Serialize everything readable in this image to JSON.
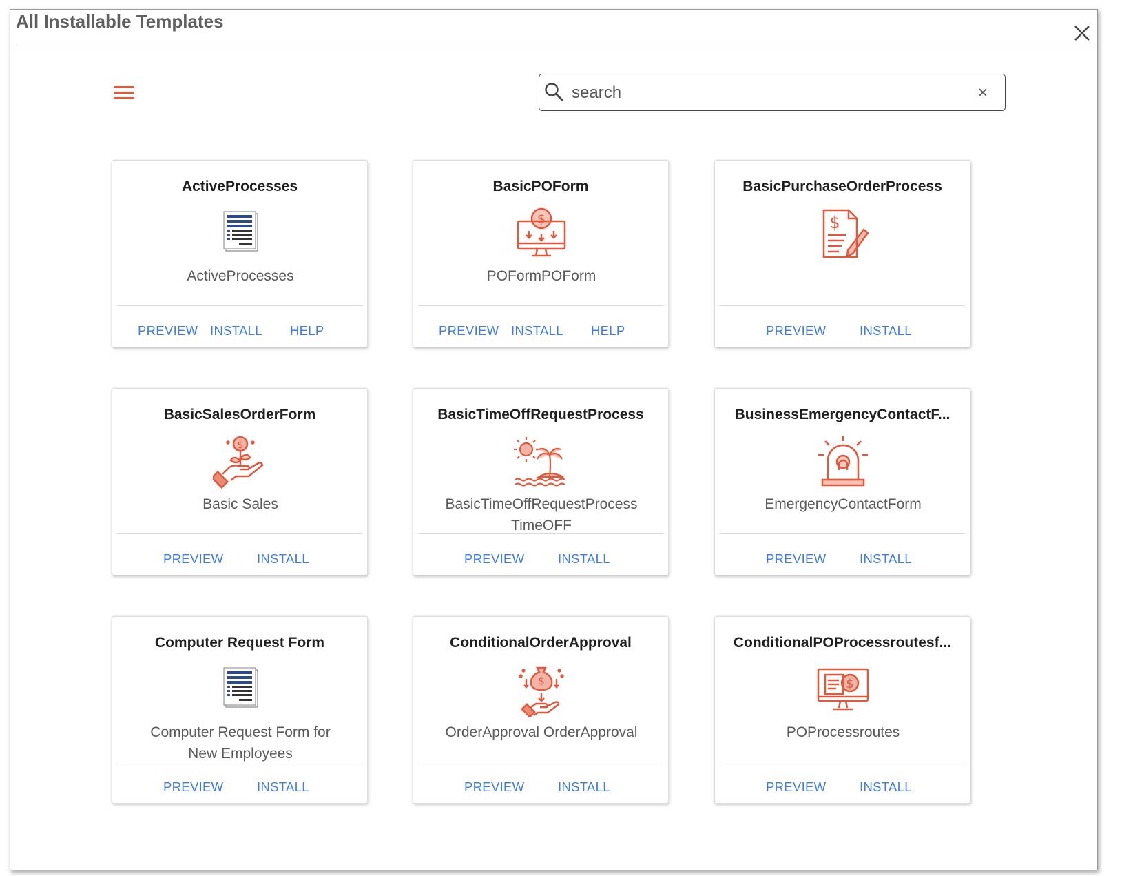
{
  "dialog": {
    "title": "All Installable Templates"
  },
  "search": {
    "placeholder": "search",
    "value": ""
  },
  "colors": {
    "accent": "#e2583a",
    "link": "#3f7de0",
    "doc_icon": "#2d4a8a"
  },
  "actions": {
    "preview": "PREVIEW",
    "install": "INSTALL",
    "help": "HELP"
  },
  "cards": [
    {
      "title": "ActiveProcesses",
      "icon": "document-list-icon",
      "desc_lines": [
        "ActiveProcesses"
      ],
      "has_help": true
    },
    {
      "title": "BasicPOForm",
      "icon": "monitor-dollar-icon",
      "desc_lines": [
        "POFormPOForm"
      ],
      "has_help": true
    },
    {
      "title": "BasicPurchaseOrderProcess",
      "icon": "invoice-pen-icon",
      "desc_lines": [],
      "has_help": false
    },
    {
      "title": "BasicSalesOrderForm",
      "icon": "hand-coin-plant-icon",
      "desc_lines": [
        "Basic Sales"
      ],
      "has_help": false
    },
    {
      "title": "BasicTimeOffRequestProcess",
      "icon": "island-sun-icon",
      "desc_lines": [
        "BasicTimeOffRequestProcess",
        "TimeOFF"
      ],
      "has_help": false
    },
    {
      "title": "BusinessEmergencyContactF...",
      "icon": "alarm-siren-icon",
      "desc_lines": [
        "EmergencyContactForm"
      ],
      "has_help": false
    },
    {
      "title": "Computer Request Form",
      "icon": "document-list-icon",
      "desc_lines": [
        "Computer Request Form for",
        "New Employees"
      ],
      "has_help": false
    },
    {
      "title": "ConditionalOrderApproval",
      "icon": "money-bag-hand-icon",
      "desc_lines": [
        "OrderApproval OrderApproval"
      ],
      "has_help": false
    },
    {
      "title": "ConditionalPOProcessroutesf...",
      "icon": "monitor-invoice-icon",
      "desc_lines": [
        "POProcessroutes"
      ],
      "has_help": false
    }
  ]
}
